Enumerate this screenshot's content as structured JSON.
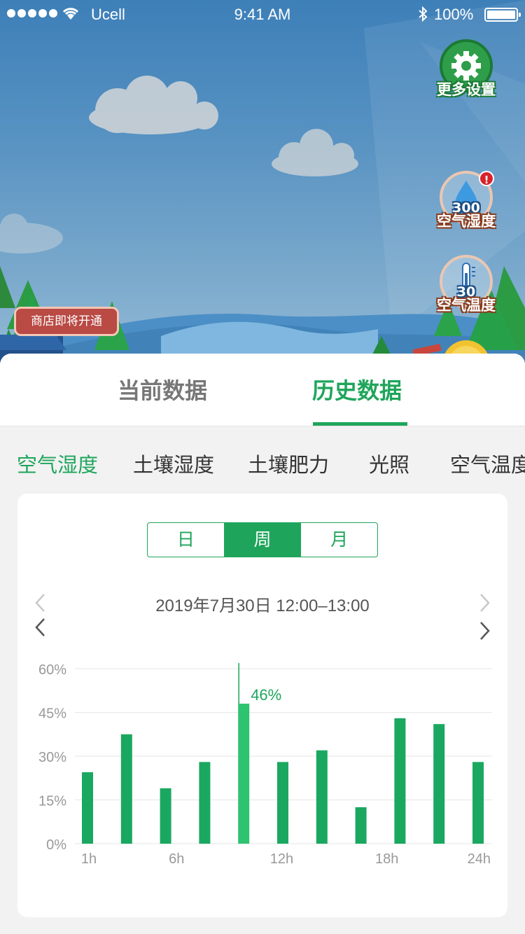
{
  "status_bar": {
    "carrier": "Ucell",
    "time": "9:41 AM",
    "battery": "100%"
  },
  "widgets": {
    "settings_label": "更多设置",
    "air_humidity": {
      "value": "300",
      "label": "空气湿度",
      "alert": "!"
    },
    "air_temperature": {
      "value": "30",
      "label": "空气温度"
    }
  },
  "shop_bubble": "商店即将开通",
  "tabs": {
    "current": "当前数据",
    "history": "历史数据"
  },
  "subtabs": [
    "空气湿度",
    "土壤湿度",
    "土壤肥力",
    "光照",
    "空气温度"
  ],
  "period": {
    "day": "日",
    "week": "周",
    "month": "月",
    "selected": "周"
  },
  "date_range": "2019年7月30日  12:00–13:00",
  "colors": {
    "accent": "#1fa55b",
    "bar": "#1aa860",
    "bar_highlight": "#2ec46f"
  },
  "chart_data": {
    "type": "bar",
    "y_ticks": [
      "60%",
      "45%",
      "30%",
      "15%",
      "0%"
    ],
    "x_ticks": [
      "1h",
      "6h",
      "12h",
      "18h",
      "24h"
    ],
    "ylim": [
      0,
      60
    ],
    "values": [
      24.5,
      37.5,
      19,
      28,
      48,
      28,
      32,
      12.5,
      43,
      41,
      28
    ],
    "highlight_index": 4,
    "highlight_label": "46%"
  }
}
